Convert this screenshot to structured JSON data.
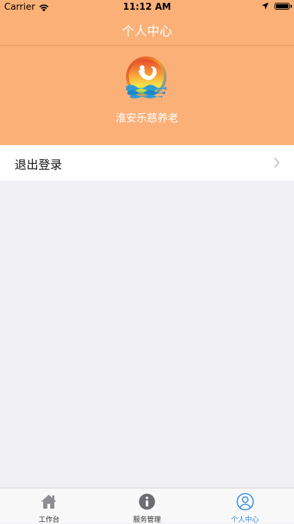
{
  "status": {
    "carrier": "Carrier",
    "time": "11:12 AM"
  },
  "nav": {
    "title": "个人中心"
  },
  "profile": {
    "org_name": "淮安乐慈养老"
  },
  "menu": {
    "items": [
      {
        "label": "退出登录"
      }
    ]
  },
  "tabbar": {
    "tabs": [
      {
        "label": "工作台",
        "icon": "home-icon",
        "active": false
      },
      {
        "label": "服务管理",
        "icon": "info-icon",
        "active": false
      },
      {
        "label": "个人中心",
        "icon": "person-icon",
        "active": true
      }
    ]
  },
  "colors": {
    "header_bg": "#fbb077",
    "tab_active": "#2f8ee8",
    "background": "#efeff4"
  }
}
